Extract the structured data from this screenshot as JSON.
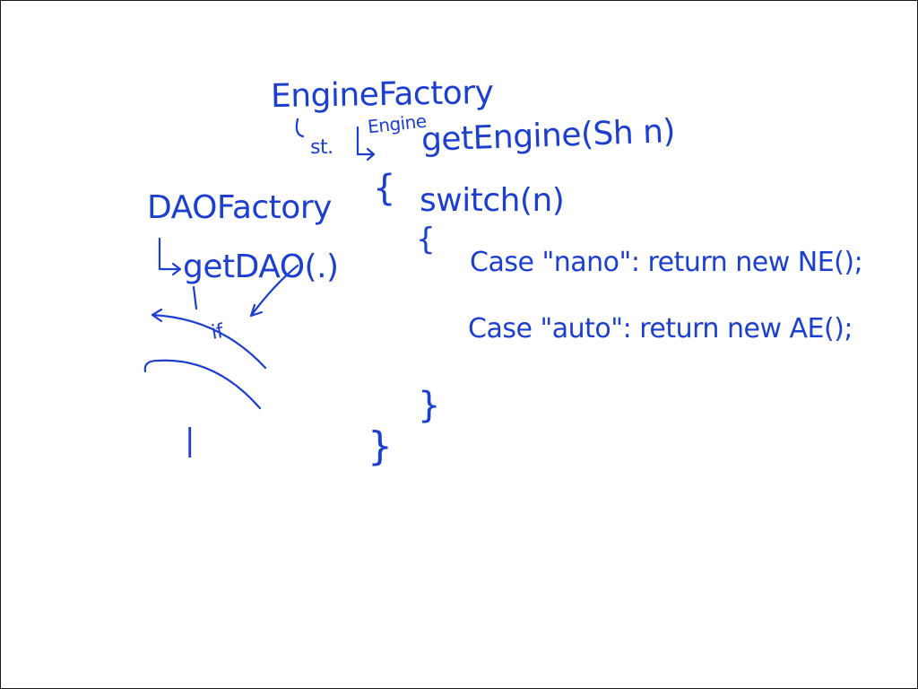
{
  "whiteboard": {
    "engine_factory": {
      "class_name": "EngineFactory",
      "static_label": "st.",
      "return_type": "Engine",
      "method_signature": "getEngine(Sh n)",
      "open_method_brace": "{",
      "switch_stmt": "switch(n)",
      "open_switch_brace": "{",
      "case_nano": "Case \"nano\": return new NE();",
      "case_auto": "Case \"auto\": return new AE();",
      "close_switch_brace": "}",
      "close_method_brace": "}"
    },
    "dao_factory": {
      "class_name": "DAOFactory",
      "method_signature": "getDAO(.)",
      "if_label": "if",
      "pipe_label": "|"
    }
  },
  "colors": {
    "ink": "#1c3fcf",
    "background": "#ffffff",
    "border": "#1a1a1a"
  }
}
